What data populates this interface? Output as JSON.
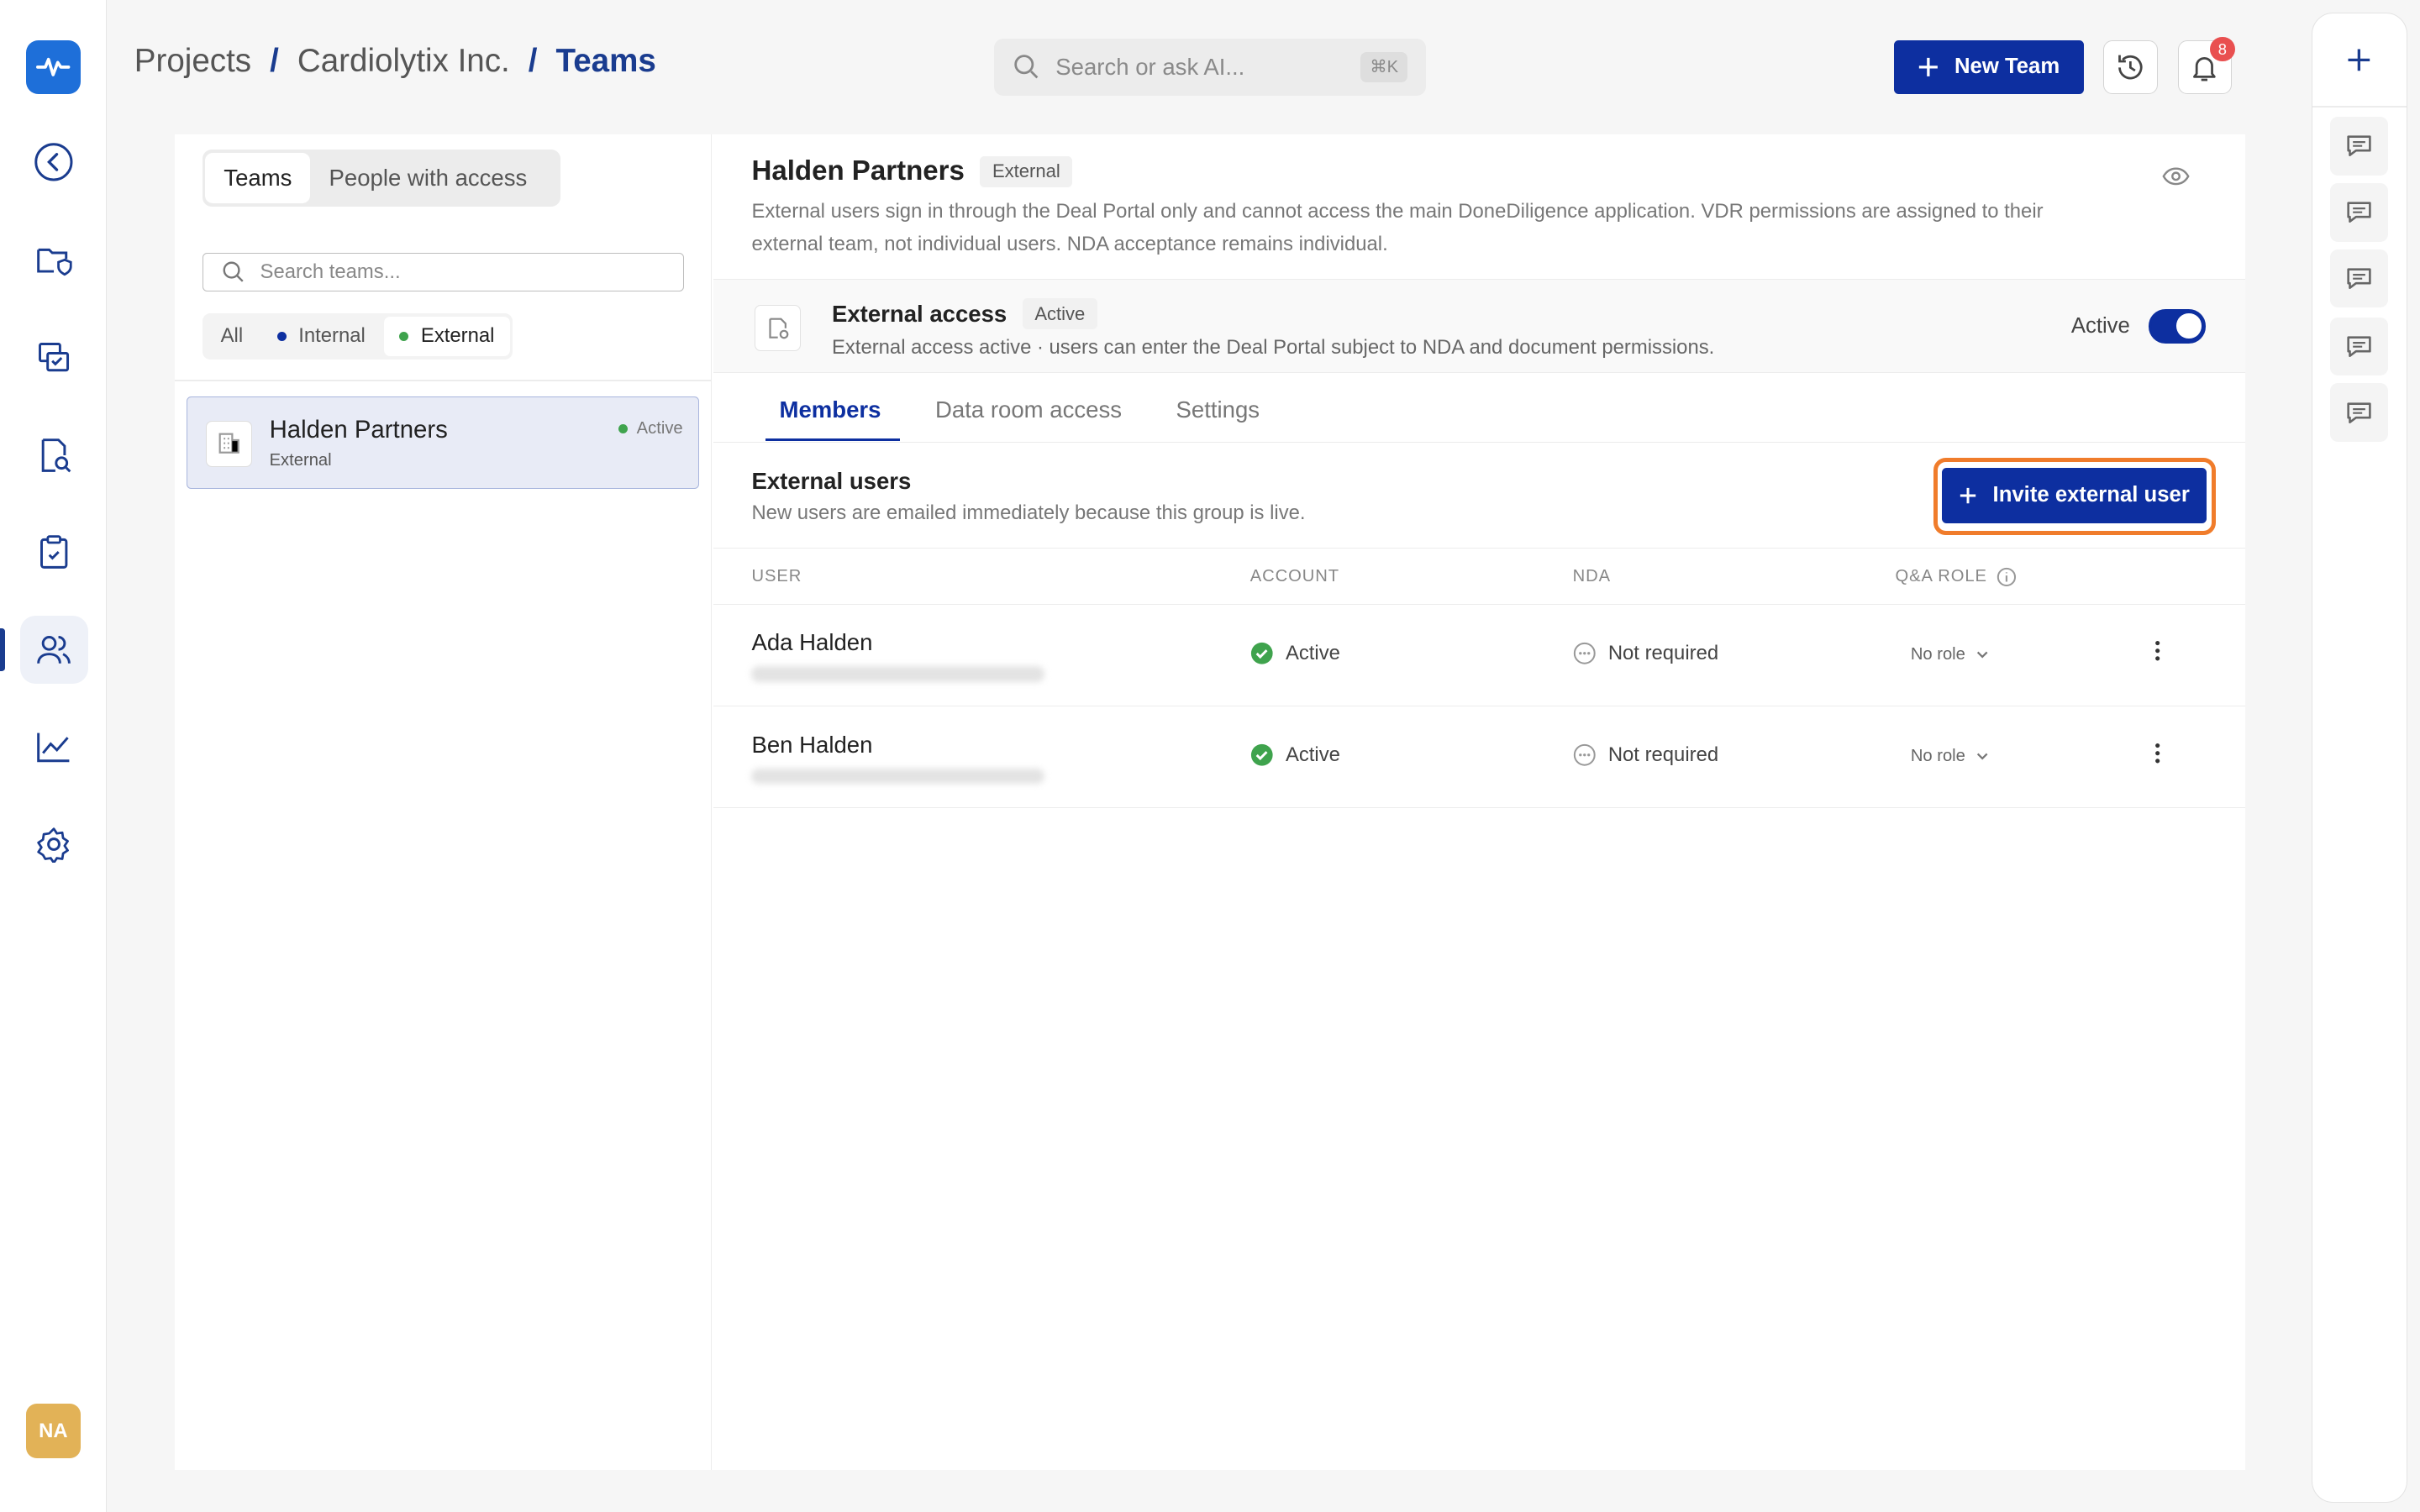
{
  "breadcrumb": {
    "items": [
      "Projects",
      "Cardiolytix Inc.",
      "Teams"
    ],
    "separator": "/"
  },
  "search": {
    "placeholder": "Search or ask AI...",
    "shortcut": "⌘K"
  },
  "header": {
    "new_team_label": "New Team",
    "notifications_count": "8"
  },
  "user": {
    "initials": "NA"
  },
  "left_pane": {
    "tabs": [
      "Teams",
      "People with access"
    ],
    "search_placeholder": "Search teams...",
    "filters": [
      "All",
      "Internal",
      "External"
    ],
    "teams": [
      {
        "name": "Halden Partners",
        "type": "External",
        "status": "Active"
      }
    ]
  },
  "team": {
    "name": "Halden Partners",
    "tag": "External",
    "description": "External users sign in through the Deal Portal only and cannot access the main DoneDiligence application. VDR permissions are assigned to their external team, not individual users. NDA acceptance remains individual.",
    "access": {
      "title": "External access",
      "badge": "Active",
      "description": "External access active · users can enter the Deal Portal subject to NDA and document permissions.",
      "toggle_label": "Active",
      "enabled": true
    },
    "tabs": [
      "Members",
      "Data room access",
      "Settings"
    ],
    "members": {
      "title": "External users",
      "subtitle": "New users are emailed immediately because this group is live.",
      "invite_label": "Invite external user",
      "columns": [
        "USER",
        "ACCOUNT",
        "NDA",
        "Q&A ROLE"
      ],
      "rows": [
        {
          "name": "Ada Halden",
          "account": "Active",
          "nda": "Not required",
          "role": "No role"
        },
        {
          "name": "Ben Halden",
          "account": "Active",
          "nda": "Not required",
          "role": "No role"
        }
      ]
    }
  },
  "colors": {
    "primary": "#0d2fa0",
    "highlight": "#f07c2b",
    "active_green": "#3fa34d",
    "logo": "#1e6fd9"
  }
}
